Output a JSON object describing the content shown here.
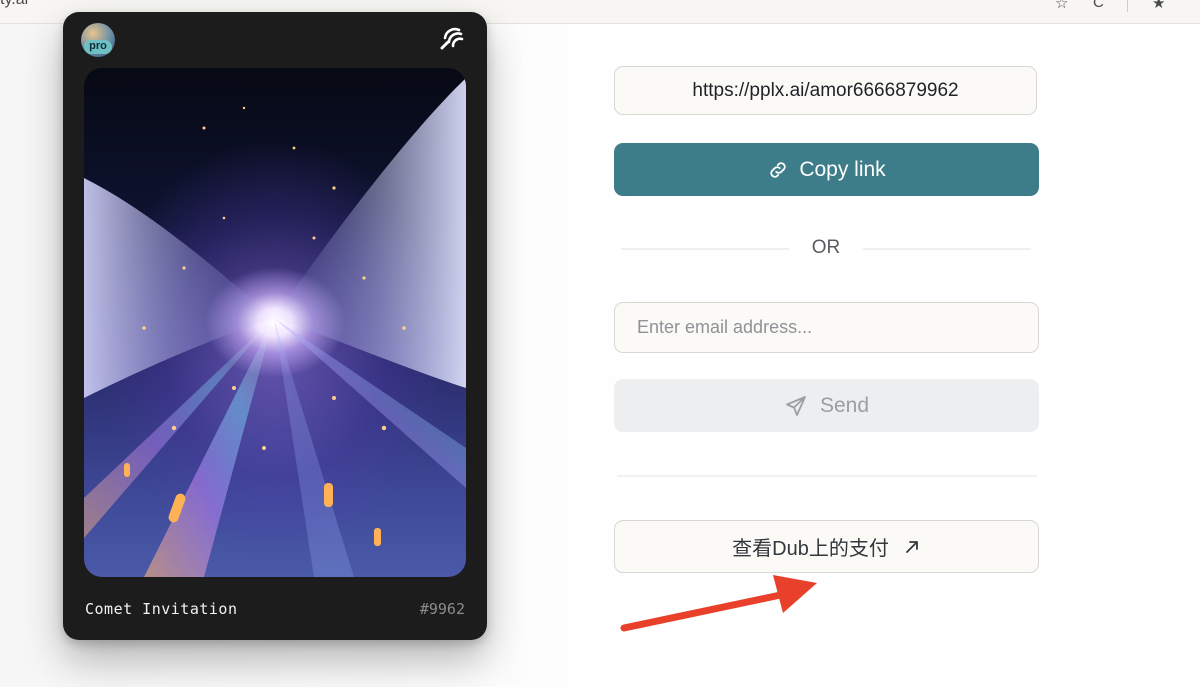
{
  "browser": {
    "url_fragment": "ty.ai"
  },
  "card": {
    "badge_text": "pro",
    "footer_title": "Comet Invitation",
    "invite_number": "#9962"
  },
  "share": {
    "link_value": "https://pplx.ai/amor6666879962",
    "copy_label": "Copy link",
    "or_label": "OR",
    "email_placeholder": "Enter email address...",
    "send_label": "Send",
    "dub_label": "查看Dub上的支付"
  },
  "colors": {
    "accent": "#3d7c89",
    "annotation_arrow": "#e8402a"
  }
}
